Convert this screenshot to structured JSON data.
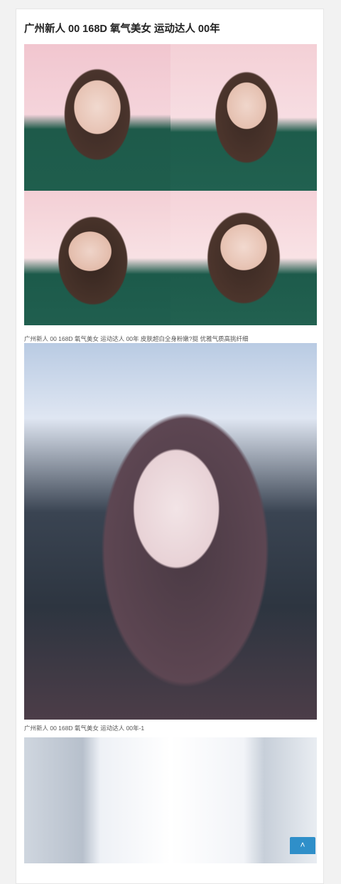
{
  "post": {
    "title": "广州新人 00 168D 氧气美女 运动达人 00年",
    "images": [
      {
        "icon": "photo-collage-image"
      },
      {
        "icon": "portrait-photo-image"
      },
      {
        "icon": "room-photo-image"
      }
    ],
    "captions": [
      "广州新人 00 168D 氧气美女 运动达人 00年   皮肤超白全身粉嫩?挺 优雅气质高挑纤细",
      "广州新人 00 168D 氧气美女 运动达人 00年-1"
    ]
  },
  "back_to_top": {
    "label": "˄",
    "icon": "chevron-up-icon"
  },
  "colors": {
    "accent": "#2f8fc9",
    "background": "#f2f2f2",
    "card": "#ffffff"
  }
}
